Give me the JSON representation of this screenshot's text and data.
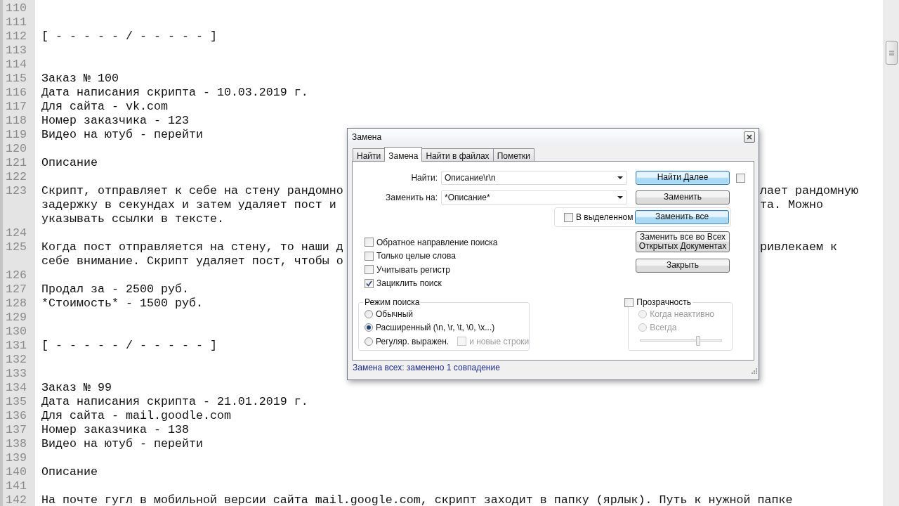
{
  "editor": {
    "lines": [
      {
        "number": "110"
      },
      {
        "number": "111"
      },
      {
        "number": "112",
        "rows": [
          {
            "text": "[ - - - - - / - - - - - ]"
          }
        ]
      },
      {
        "number": "113"
      },
      {
        "number": "114"
      },
      {
        "number": "115",
        "rows": [
          {
            "text": "Заказ № 100"
          }
        ]
      },
      {
        "number": "116",
        "rows": [
          {
            "text": "Дата написания скрипта - 10.03.2019 г."
          }
        ]
      },
      {
        "number": "117",
        "rows": [
          {
            "text": "Для сайта - vk.com"
          }
        ]
      },
      {
        "number": "118",
        "rows": [
          {
            "text": "Номер заказчика - 123"
          }
        ]
      },
      {
        "number": "119",
        "rows": [
          {
            "text": "Видео на ютуб - перейти"
          }
        ]
      },
      {
        "number": "120"
      },
      {
        "number": "121",
        "rows": [
          {
            "text": "Описание"
          }
        ]
      },
      {
        "number": "122"
      },
      {
        "number": "123",
        "rows": [
          {
            "text": "Скрипт, отправляет к себе на стену рандомно",
            "right_part": "лает рандомную"
          },
          {
            "text": "задержку в секундах и затем удаляет пост и",
            "right_part": "та. Можно"
          },
          {
            "text": "указывать ссылки в тексте."
          }
        ]
      },
      {
        "number": "124"
      },
      {
        "number": "125",
        "rows": [
          {
            "text": "Когда пост отправляется на стену, то наши д",
            "right_part": "ривлекаем к"
          },
          {
            "text": "себе внимание. Скрипт удаляет пост, чтобы о"
          }
        ]
      },
      {
        "number": "126"
      },
      {
        "number": "127",
        "rows": [
          {
            "text": "Продал за - 2500 руб."
          }
        ]
      },
      {
        "number": "128",
        "rows": [
          {
            "text": "*Стоимость* - 1500 руб."
          }
        ]
      },
      {
        "number": "129"
      },
      {
        "number": "130"
      },
      {
        "number": "131",
        "rows": [
          {
            "text": "[ - - - - - / - - - - - ]"
          }
        ]
      },
      {
        "number": "132"
      },
      {
        "number": "133"
      },
      {
        "number": "134",
        "rows": [
          {
            "text": "Заказ № 99"
          }
        ]
      },
      {
        "number": "135",
        "rows": [
          {
            "text": "Дата написания скрипта - 21.01.2019 г."
          }
        ]
      },
      {
        "number": "136",
        "rows": [
          {
            "text": "Для сайта - mail.goodle.com"
          }
        ]
      },
      {
        "number": "137",
        "rows": [
          {
            "text": "Номер заказчика - 138"
          }
        ]
      },
      {
        "number": "138",
        "rows": [
          {
            "text": "Видео на ютуб - перейти"
          }
        ]
      },
      {
        "number": "139"
      },
      {
        "number": "140",
        "rows": [
          {
            "text": "Описание"
          }
        ]
      },
      {
        "number": "141"
      },
      {
        "number": "142",
        "rows": [
          {
            "text": "На почте гугл в мобильной версии сайта mail.google.com, скрипт заходит в папку (ярлык). Путь к нужной папке"
          }
        ]
      }
    ]
  },
  "replace_dialog": {
    "title": "Замена",
    "tabs": [
      {
        "label": "Найти",
        "selected": false
      },
      {
        "label": "Замена",
        "selected": true
      },
      {
        "label": "Найти в файлах",
        "selected": false
      },
      {
        "label": "Пометки",
        "selected": false
      }
    ],
    "fields": [
      {
        "label": "Найти:",
        "value": "Описание\\r\\n"
      },
      {
        "label": "Заменить на:",
        "value": "*Описание*"
      }
    ],
    "buttons": [
      {
        "label": "Найти Далее",
        "highlighted": true
      },
      {
        "label": "Заменить",
        "highlighted": false
      },
      {
        "label": "Заменить все",
        "highlighted": true
      },
      {
        "label": "Заменить все во Всех Открытых Документах",
        "highlighted": false
      },
      {
        "label": "Закрыть",
        "highlighted": false
      }
    ],
    "side_checkbox": {
      "checked": false
    },
    "in_selection": {
      "label": "В выделенном",
      "checked": false
    },
    "options": [
      {
        "label": "Обратное направление поиска",
        "checked": false
      },
      {
        "label": "Только целые слова",
        "checked": false
      },
      {
        "label": "Учитывать регистр",
        "checked": false
      },
      {
        "label": "Зациклить поиск",
        "checked": true
      }
    ],
    "search_mode": {
      "title": "Режим поиска",
      "modes": [
        {
          "label": "Обычный",
          "selected": false
        },
        {
          "label": "Расширенный (\\n, \\r, \\t, \\0, \\x...)",
          "selected": true
        },
        {
          "label": "Регуляр. выражен.",
          "selected": false
        }
      ],
      "newlines_option": {
        "label": "и новые строки",
        "checked": false,
        "disabled": true
      }
    },
    "transparency": {
      "label": "Прозрачность",
      "checked": false,
      "modes": [
        {
          "label": "Когда неактивно",
          "selected": false,
          "disabled": true
        },
        {
          "label": "Всегда",
          "selected": false,
          "disabled": true
        }
      ],
      "slider": {
        "level": 0.71,
        "disabled": true
      }
    },
    "status": "Замена всех: заменено 1 совпадение"
  }
}
